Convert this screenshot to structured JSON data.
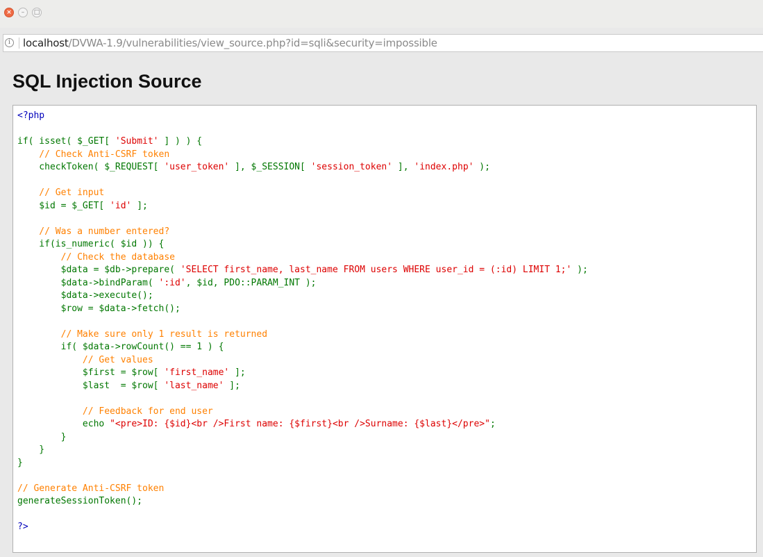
{
  "window": {
    "controls": {
      "close_glyph": "×",
      "minimize_glyph": "–",
      "maximize_glyph": "□"
    }
  },
  "address_bar": {
    "info_icon": "info-icon",
    "host": "localhost",
    "path": "/DVWA-1.9/vulnerabilities/view_source.php?id=sqli&security=impossible"
  },
  "page": {
    "title": "SQL Injection Source"
  },
  "code": {
    "colors": {
      "keyword": "#007700",
      "string": "#dd0000",
      "comment": "#ff8000",
      "identifier": "#0000bb"
    },
    "lines": [
      [
        [
          "id",
          "<?php"
        ]
      ],
      [],
      [
        [
          "kw",
          "if( isset( $_GET[ "
        ],
        [
          "str",
          "'Submit'"
        ],
        [
          "kw",
          " ] ) ) {"
        ]
      ],
      [
        [
          "cm",
          "    // Check Anti-CSRF token"
        ]
      ],
      [
        [
          "kw",
          "    checkToken( $_REQUEST[ "
        ],
        [
          "str",
          "'user_token'"
        ],
        [
          "kw",
          " ], $_SESSION[ "
        ],
        [
          "str",
          "'session_token'"
        ],
        [
          "kw",
          " ], "
        ],
        [
          "str",
          "'index.php'"
        ],
        [
          "kw",
          " );"
        ]
      ],
      [],
      [
        [
          "cm",
          "    // Get input"
        ]
      ],
      [
        [
          "kw",
          "    $id = $_GET[ "
        ],
        [
          "str",
          "'id'"
        ],
        [
          "kw",
          " ];"
        ]
      ],
      [],
      [
        [
          "cm",
          "    // Was a number entered?"
        ]
      ],
      [
        [
          "kw",
          "    if(is_numeric( $id )) {"
        ]
      ],
      [
        [
          "cm",
          "        // Check the database"
        ]
      ],
      [
        [
          "kw",
          "        $data = $db->prepare( "
        ],
        [
          "str",
          "'SELECT first_name, last_name FROM users WHERE user_id = (:id) LIMIT 1;'"
        ],
        [
          "kw",
          " );"
        ]
      ],
      [
        [
          "kw",
          "        $data->bindParam( "
        ],
        [
          "str",
          "':id'"
        ],
        [
          "kw",
          ", $id, PDO::PARAM_INT );"
        ]
      ],
      [
        [
          "kw",
          "        $data->execute();"
        ]
      ],
      [
        [
          "kw",
          "        $row = $data->fetch();"
        ]
      ],
      [],
      [
        [
          "cm",
          "        // Make sure only 1 result is returned"
        ]
      ],
      [
        [
          "kw",
          "        if( $data->rowCount() == 1 ) {"
        ]
      ],
      [
        [
          "cm",
          "            // Get values"
        ]
      ],
      [
        [
          "kw",
          "            $first = $row[ "
        ],
        [
          "str",
          "'first_name'"
        ],
        [
          "kw",
          " ];"
        ]
      ],
      [
        [
          "kw",
          "            $last  = $row[ "
        ],
        [
          "str",
          "'last_name'"
        ],
        [
          "kw",
          " ];"
        ]
      ],
      [],
      [
        [
          "cm",
          "            // Feedback for end user"
        ]
      ],
      [
        [
          "kw",
          "            echo "
        ],
        [
          "str",
          "\"<pre>ID: {$id}<br />First name: {$first}<br />Surname: {$last}</pre>\""
        ],
        [
          "kw",
          ";"
        ]
      ],
      [
        [
          "kw",
          "        }"
        ]
      ],
      [
        [
          "kw",
          "    }"
        ]
      ],
      [
        [
          "kw",
          "}"
        ]
      ],
      [],
      [
        [
          "cm",
          "// Generate Anti-CSRF token"
        ]
      ],
      [
        [
          "kw",
          "generateSessionToken();"
        ]
      ],
      [],
      [
        [
          "id",
          "?>"
        ]
      ]
    ]
  }
}
